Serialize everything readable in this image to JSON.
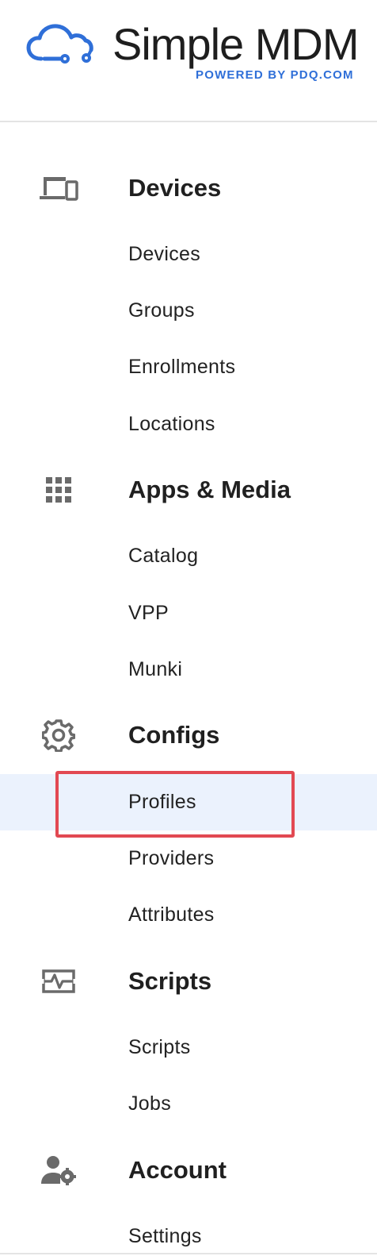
{
  "brand": {
    "title": "Simple MDM",
    "subtitle": "POWERED BY PDQ.COM",
    "accent_color": "#2f6fd8"
  },
  "sections": [
    {
      "title": "Devices",
      "icon": "devices-icon",
      "items": [
        {
          "label": "Devices",
          "active": false
        },
        {
          "label": "Groups",
          "active": false
        },
        {
          "label": "Enrollments",
          "active": false
        },
        {
          "label": "Locations",
          "active": false
        }
      ]
    },
    {
      "title": "Apps & Media",
      "icon": "apps-grid-icon",
      "items": [
        {
          "label": "Catalog",
          "active": false
        },
        {
          "label": "VPP",
          "active": false
        },
        {
          "label": "Munki",
          "active": false
        }
      ]
    },
    {
      "title": "Configs",
      "icon": "gear-icon",
      "items": [
        {
          "label": "Profiles",
          "active": true
        },
        {
          "label": "Providers",
          "active": false
        },
        {
          "label": "Attributes",
          "active": false
        }
      ]
    },
    {
      "title": "Scripts",
      "icon": "script-pulse-icon",
      "items": [
        {
          "label": "Scripts",
          "active": false
        },
        {
          "label": "Jobs",
          "active": false
        }
      ]
    },
    {
      "title": "Account",
      "icon": "account-settings-icon",
      "items": [
        {
          "label": "Settings",
          "active": false
        }
      ]
    }
  ],
  "colors": {
    "active_background": "#ebf2fd",
    "highlight_border": "#e24952",
    "icon_gray": "#6a6a6a"
  }
}
